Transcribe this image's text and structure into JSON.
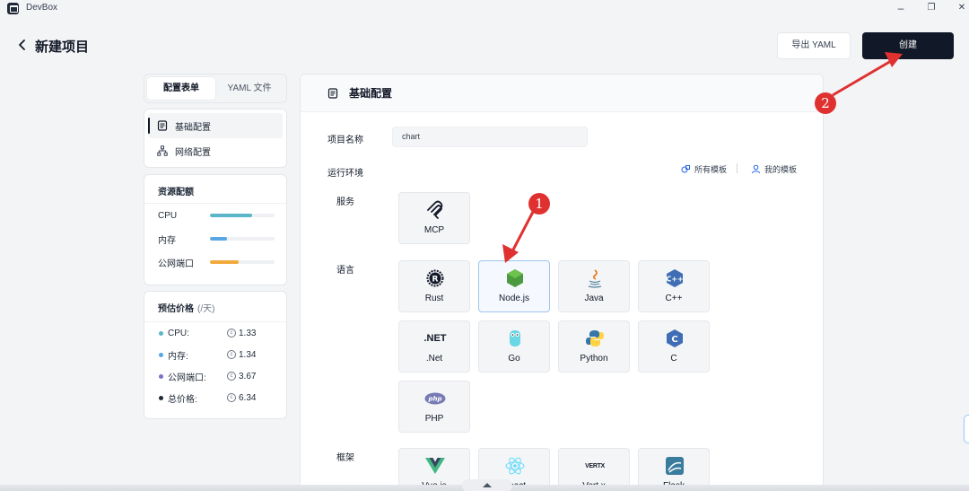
{
  "app": {
    "title": "DevBox"
  },
  "window": {
    "minimize": "–",
    "restore": "❐",
    "close": "✕"
  },
  "header": {
    "title": "新建项目",
    "export_label": "导出 YAML",
    "create_label": "创建"
  },
  "left": {
    "tabs": [
      {
        "label": "配置表单",
        "active": true
      },
      {
        "label": "YAML 文件",
        "active": false
      }
    ],
    "nav": [
      {
        "label": "基础配置",
        "icon": "document-icon",
        "active": true
      },
      {
        "label": "网络配置",
        "icon": "network-icon",
        "active": false
      }
    ],
    "resources": {
      "title": "资源配额",
      "items": [
        {
          "label": "CPU",
          "level": 0.65,
          "color": "#5bb6c9"
        },
        {
          "label": "内存",
          "level": 0.27,
          "color": "#58a7e3"
        },
        {
          "label": "公网端口",
          "level": 0.45,
          "color": "#f2a93b"
        }
      ]
    },
    "price": {
      "title": "预估价格",
      "unit": "(/天)",
      "items": [
        {
          "label": "CPU:",
          "value": "1.33",
          "color": "#5bb6c9"
        },
        {
          "label": "内存:",
          "value": "1.34",
          "color": "#58a7e3"
        },
        {
          "label": "公网端口:",
          "value": "3.67",
          "color": "#7c6fc7"
        },
        {
          "label": "总价格:",
          "value": "6.34",
          "color": "#1f2937"
        }
      ]
    }
  },
  "main": {
    "section_title": "基础配置",
    "project_name_label": "项目名称",
    "project_name_value": "chart",
    "runtime_label": "运行环境",
    "all_templates": "所有模板",
    "my_templates": "我的模板",
    "groups": {
      "service": {
        "label": "服务",
        "items": [
          "MCP"
        ]
      },
      "language": {
        "label": "语言",
        "items": [
          "Rust",
          "Node.js",
          "Java",
          "C++",
          ".Net",
          "Go",
          "Python",
          "C",
          "PHP"
        ]
      },
      "framework": {
        "label": "框架",
        "items": [
          "Vue.js",
          "React",
          "Vert.x",
          "Flask"
        ]
      }
    },
    "selected": "Node.js",
    "net_icon_text": ".NET",
    "vertx_icon_text": "VERTX",
    "php_icon_text": "php",
    "rust_icon_text": "R",
    "cpp_icon_text": "C++",
    "c_icon_text": "C"
  },
  "annotations": [
    "1",
    "2"
  ],
  "colors": {
    "primary": "#111827",
    "annotation": "#e03131",
    "selected_border": "#9ec5ee"
  }
}
